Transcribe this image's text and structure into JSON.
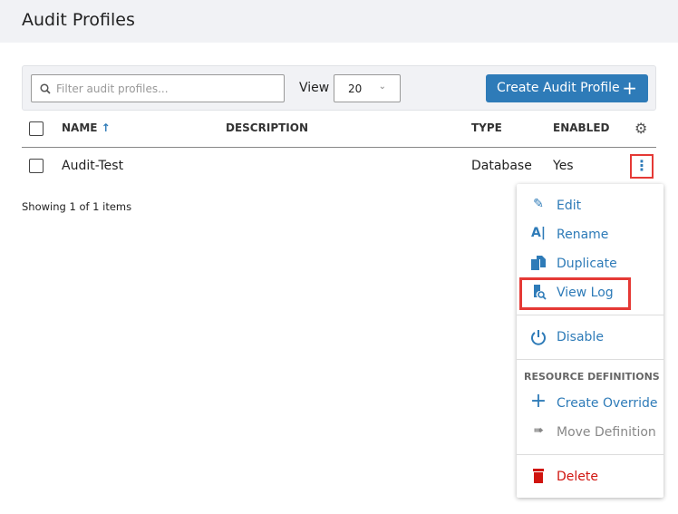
{
  "header": {
    "title": "Audit Profiles"
  },
  "toolbar": {
    "search_placeholder": "Filter audit profiles...",
    "view_label": "View",
    "page_size": "20",
    "create_label": "Create Audit Profile"
  },
  "table": {
    "columns": [
      "NAME",
      "DESCRIPTION",
      "TYPE",
      "ENABLED"
    ],
    "rows": [
      {
        "name": "Audit-Test",
        "description": "",
        "type": "Database",
        "enabled": "Yes"
      }
    ]
  },
  "footer": {
    "showing": "Showing 1 of 1 items"
  },
  "menu": {
    "items": [
      {
        "label": "Edit",
        "icon": "pencil-icon"
      },
      {
        "label": "Rename",
        "icon": "rename-icon"
      },
      {
        "label": "Duplicate",
        "icon": "duplicate-icon"
      },
      {
        "label": "View Log",
        "icon": "view-log-icon"
      },
      {
        "label": "Disable",
        "icon": "power-icon"
      }
    ],
    "section_title": "RESOURCE DEFINITIONS",
    "section_items": [
      {
        "label": "Create Override",
        "icon": "plus-icon"
      },
      {
        "label": "Move Definition",
        "icon": "move-icon"
      }
    ],
    "delete_label": "Delete"
  },
  "colors": {
    "accent": "#2e7bb8",
    "danger": "#d0140f",
    "highlight": "#e53935"
  }
}
